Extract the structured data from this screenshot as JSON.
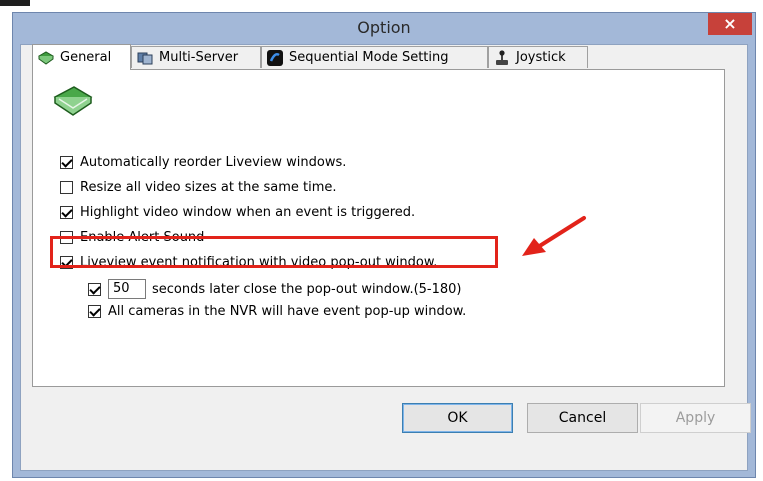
{
  "window": {
    "title": "Option",
    "close_glyph": "×"
  },
  "tabs": [
    {
      "label": "General",
      "icon": "book-icon"
    },
    {
      "label": "Multi-Server",
      "icon": "server-icon"
    },
    {
      "label": "Sequential Mode Setting",
      "icon": "sequential-icon"
    },
    {
      "label": "Joystick",
      "icon": "joystick-icon"
    }
  ],
  "general": {
    "options": [
      {
        "label": "Automatically reorder Liveview windows.",
        "checked": true
      },
      {
        "label": "Resize all video sizes at the same time.",
        "checked": false
      },
      {
        "label": "Highlight video window when an event is triggered.",
        "checked": true
      },
      {
        "label": "Enable Alert Sound",
        "checked": false
      },
      {
        "label": "Liveview event notification with video pop-out window.",
        "checked": true
      }
    ],
    "popout_close": {
      "checked": true,
      "value": "50",
      "label": "seconds later close the pop-out window.(5-180)"
    },
    "all_cameras": {
      "checked": true,
      "label": "All cameras in the NVR will have event pop-up window."
    }
  },
  "buttons": {
    "ok": "OK",
    "cancel": "Cancel",
    "apply": "Apply"
  },
  "colors": {
    "accent": "#e2231a",
    "close": "#c7413a",
    "frame": "#a3b8d8"
  }
}
